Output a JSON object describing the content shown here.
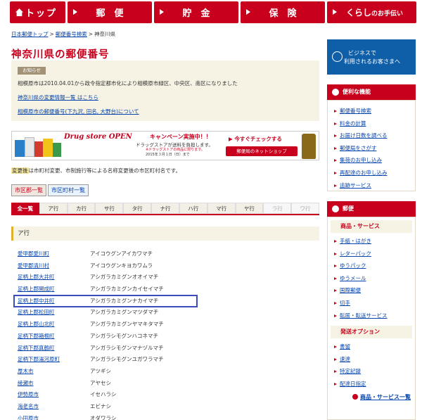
{
  "nav": [
    {
      "label": "トップ",
      "icon": "home-icon"
    },
    {
      "label": "郵　便",
      "icon": "arrow-icon"
    },
    {
      "label": "貯　金",
      "icon": "arrow-icon"
    },
    {
      "label": "保　険",
      "icon": "arrow-icon"
    },
    {
      "label_main": "くらし",
      "label_sub": "のお手伝い",
      "icon": "arrow-icon"
    }
  ],
  "breadcrumb": [
    "日本郵便トップ",
    "郵便番号検索",
    "神奈川県"
  ],
  "page_title": "神奈川県の郵便番号",
  "notice": {
    "tag": "お知らせ",
    "text": "相模原市は2010.04.01から政令指定都市化により相模原市緑区、中央区、南区になりました",
    "link1": "神奈川県の変更情報一覧 はこちら",
    "link2": "相模原市の郵便番号(下九沢, 田名, 大野台)について"
  },
  "banner": {
    "drugstore": "Drug store OPEN",
    "campaign": "キャンペーン実施中！！",
    "campaign_sub": "ドラッグストアが送料を負担します。",
    "campaign_note": "※ドラッグストアの商品に限ります。",
    "date_note": "2015年３月１日（日）まで",
    "check": "今すぐチェックする",
    "shop": "郵便局のネットショップ"
  },
  "legend": {
    "tag": "変更後",
    "text": "は市町村変更、市制施行等による名称変更後の市区町村名です。"
  },
  "view_buttons": [
    "市区郡一覧",
    "市区町村一覧"
  ],
  "gyo_tabs": [
    {
      "label": "全一覧",
      "state": "active"
    },
    {
      "label": "ア行",
      "state": "normal"
    },
    {
      "label": "カ行",
      "state": "normal"
    },
    {
      "label": "サ行",
      "state": "normal"
    },
    {
      "label": "タ行",
      "state": "normal"
    },
    {
      "label": "ナ行",
      "state": "normal"
    },
    {
      "label": "ハ行",
      "state": "normal"
    },
    {
      "label": "マ行",
      "state": "normal"
    },
    {
      "label": "ヤ行",
      "state": "normal"
    },
    {
      "label": "ラ行",
      "state": "disabled"
    },
    {
      "label": "ワ行",
      "state": "disabled"
    }
  ],
  "section_title": "ア行",
  "cities": [
    {
      "name": "愛甲郡愛川町",
      "kana": "アイコウグンアイカワマチ"
    },
    {
      "name": "愛甲郡清川村",
      "kana": "アイコウグンキヨカワムラ"
    },
    {
      "name": "足柄上郡大井町",
      "kana": "アシガラカミグンオオイマチ"
    },
    {
      "name": "足柄上郡開成町",
      "kana": "アシガラカミグンカイセイマチ"
    },
    {
      "name": "足柄上郡中井町",
      "kana": "アシガラカミグンナカイマチ",
      "selected": true
    },
    {
      "name": "足柄上郡松田町",
      "kana": "アシガラカミグンマツダマチ"
    },
    {
      "name": "足柄上郡山北町",
      "kana": "アシガラカミグンヤマキタマチ"
    },
    {
      "name": "足柄下郡箱根町",
      "kana": "アシガラシモグンハコネマチ"
    },
    {
      "name": "足柄下郡真鶴町",
      "kana": "アシガラシモグンマナヅルマチ"
    },
    {
      "name": "足柄下郡湯河原町",
      "kana": "アシガラシモグンユガワラマチ"
    },
    {
      "name": "厚木市",
      "kana": "アツギシ"
    },
    {
      "name": "綾瀬市",
      "kana": "アヤセシ"
    },
    {
      "name": "伊勢原市",
      "kana": "イセハラシ"
    },
    {
      "name": "海老名市",
      "kana": "エビナシ"
    },
    {
      "name": "小田原市",
      "kana": "オダワラシ"
    }
  ],
  "sidebar": {
    "business_line1": "ビジネスで",
    "business_line2": "利用されるお客さまへ",
    "features_title": "便利な機能",
    "features": [
      "郵便番号検索",
      "料金の計算",
      "お届け日数を調べる",
      "郵便局をさがす",
      "集荷のお申し込み",
      "再配達のお申し込み",
      "追跡サービス"
    ],
    "post_title": "郵便",
    "products_title": "商品・サービス",
    "products": [
      "手紙・はがき",
      "レターパック",
      "ゆうパック",
      "ゆうメール",
      "国際郵便",
      "切手",
      "転居・転送サービス"
    ],
    "options_title": "発送オプション",
    "options": [
      "書留",
      "速達",
      "特定記録",
      "配達日指定"
    ],
    "more": "商品・サービス一覧"
  },
  "colors": {
    "brand_red": "#c9001d",
    "link_blue": "#0645ad",
    "business_blue": "#0f5ea8",
    "selection_outline": "#3b4cc0"
  }
}
